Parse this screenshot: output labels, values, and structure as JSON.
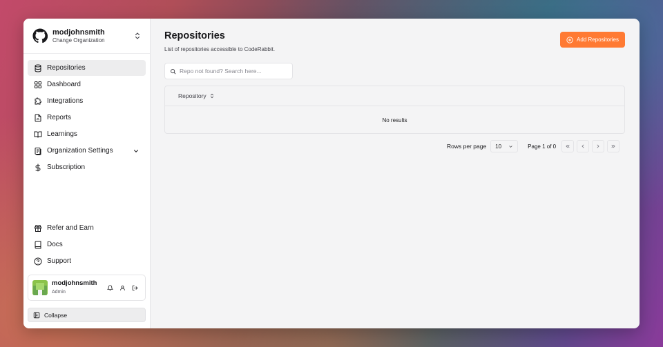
{
  "org": {
    "name": "modjohnsmith",
    "subtitle": "Change Organization"
  },
  "sidebar": {
    "items": [
      {
        "label": "Repositories",
        "icon": "database-icon",
        "active": true
      },
      {
        "label": "Dashboard",
        "icon": "grid-icon"
      },
      {
        "label": "Integrations",
        "icon": "puzzle-icon"
      },
      {
        "label": "Reports",
        "icon": "report-icon"
      },
      {
        "label": "Learnings",
        "icon": "book-open-icon"
      },
      {
        "label": "Organization Settings",
        "icon": "settings-doc-icon"
      },
      {
        "label": "Subscription",
        "icon": "dollar-icon"
      }
    ],
    "bottom": [
      {
        "label": "Refer and Earn",
        "icon": "gift-icon"
      },
      {
        "label": "Docs",
        "icon": "book-icon"
      },
      {
        "label": "Support",
        "icon": "help-circle-icon"
      }
    ],
    "collapse_label": "Collapse"
  },
  "user": {
    "name": "modjohnsmith",
    "role": "Admin"
  },
  "main": {
    "title": "Repositories",
    "subtitle": "List of repositories accessible to CodeRabbit.",
    "add_button": "Add Repositories",
    "search_placeholder": "Repo not found? Search here...",
    "table": {
      "column": "Repository",
      "empty": "No results"
    },
    "pager": {
      "rows_label": "Rows per page",
      "rows_value": "10",
      "page_info": "Page 1 of 0"
    }
  },
  "colors": {
    "accent": "#ff7a33",
    "avatar": "#8bc34a"
  }
}
